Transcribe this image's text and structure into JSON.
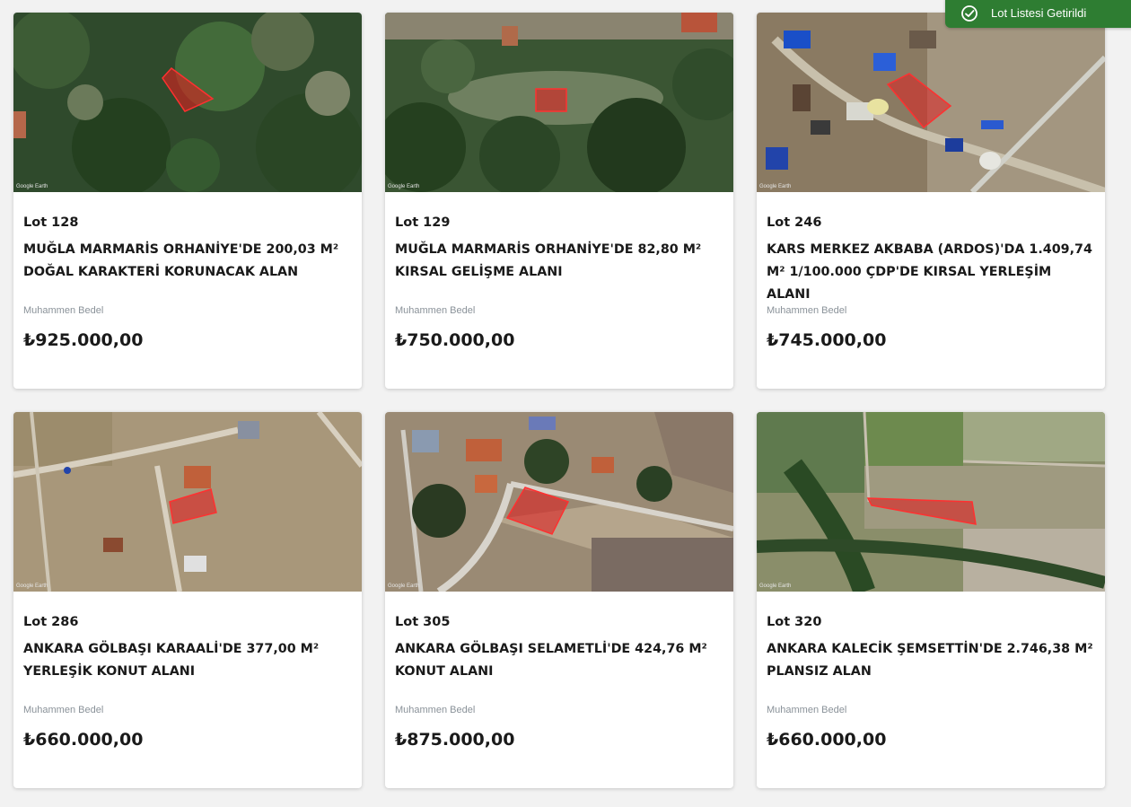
{
  "toast": {
    "message": "Lot Listesi Getirildi",
    "icon": "check-circle-icon",
    "color": "#2e7d32"
  },
  "lots": [
    {
      "lot": "Lot 128",
      "title": "MUĞLA MARMARİS ORHANİYE'DE 200,03 M² DOĞAL KARAKTERİ KORUNACAK ALAN",
      "price_label": "Muhammen Bedel",
      "price": "₺925.000,00",
      "image_label": "Google Earth"
    },
    {
      "lot": "Lot 129",
      "title": "MUĞLA MARMARİS ORHANİYE'DE 82,80 M² KIRSAL GELİŞME ALANI",
      "price_label": "Muhammen Bedel",
      "price": "₺750.000,00",
      "image_label": "Google Earth"
    },
    {
      "lot": "Lot 246",
      "title": "KARS MERKEZ AKBABA (ARDOS)'DA 1.409,74 M² 1/100.000 ÇDP'DE KIRSAL YERLEŞİM ALANI",
      "price_label": "Muhammen Bedel",
      "price": "₺745.000,00",
      "image_label": "Google Earth"
    },
    {
      "lot": "Lot 286",
      "title": "ANKARA GÖLBAŞI KARAALİ'DE 377,00 M² YERLEŞİK KONUT ALANI",
      "price_label": "Muhammen Bedel",
      "price": "₺660.000,00",
      "image_label": "Google Earth"
    },
    {
      "lot": "Lot 305",
      "title": "ANKARA GÖLBAŞI SELAMETLİ'DE 424,76 M² KONUT ALANI",
      "price_label": "Muhammen Bedel",
      "price": "₺875.000,00",
      "image_label": "Google Earth"
    },
    {
      "lot": "Lot 320",
      "title": "ANKARA KALECİK ŞEMSETTİN'DE 2.746,38 M² PLANSIZ ALAN",
      "price_label": "Muhammen Bedel",
      "price": "₺660.000,00",
      "image_label": "Google Earth"
    }
  ]
}
